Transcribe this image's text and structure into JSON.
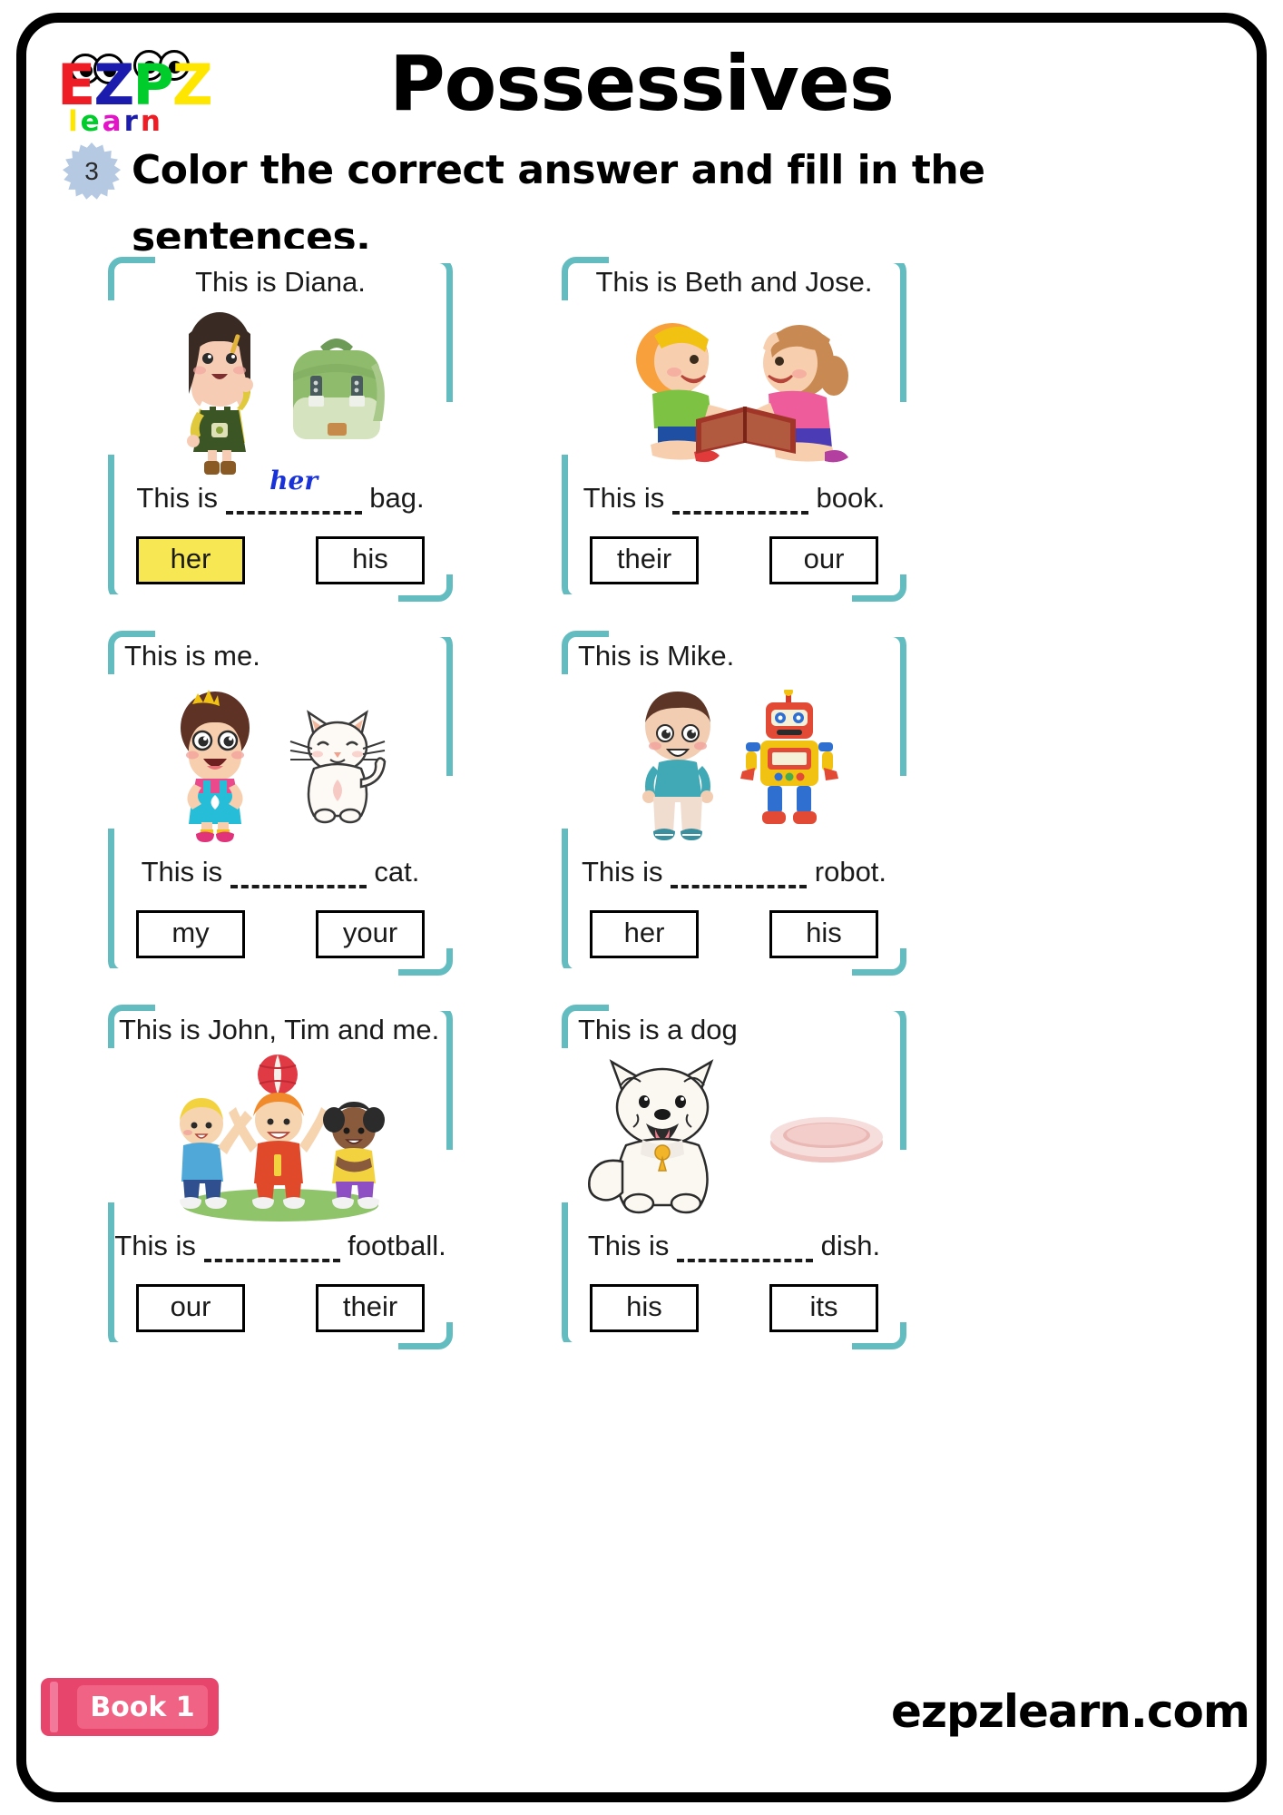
{
  "brand": {
    "logo_line1": [
      "E",
      "Z",
      "P",
      "Z"
    ],
    "logo_line2": [
      "l",
      "e",
      "a",
      "r",
      "n"
    ],
    "accent_teal": "#62bcc0",
    "accent_yellow": "#f7e752",
    "accent_blue_ink": "#1832d8",
    "accent_pink": "#e8456c",
    "badge_blue": "#b5c9e2"
  },
  "header": {
    "title": "Possessives"
  },
  "instruction": {
    "number": "3",
    "text": "Color the correct answer and fill in the sentences."
  },
  "cards": [
    {
      "id": "diana-bag",
      "title": "This is Diana.",
      "sentence_before": "This is",
      "sentence_after": "bag.",
      "answer": "her",
      "options": [
        {
          "label": "her",
          "selected": true
        },
        {
          "label": "his",
          "selected": false
        }
      ],
      "art": [
        "girl-green-dress",
        "green-backpack"
      ]
    },
    {
      "id": "beth-jose-book",
      "title": "This is Beth and Jose.",
      "sentence_before": "This is",
      "sentence_after": "book.",
      "answer": "",
      "options": [
        {
          "label": "their",
          "selected": false
        },
        {
          "label": "our",
          "selected": false
        }
      ],
      "art": [
        "two-kids-reading-book"
      ]
    },
    {
      "id": "me-cat",
      "title": "This is me.",
      "sentence_before": "This is",
      "sentence_after": "cat.",
      "answer": "",
      "options": [
        {
          "label": "my",
          "selected": false
        },
        {
          "label": "your",
          "selected": false
        }
      ],
      "art": [
        "girl-crown-blue-overalls",
        "white-cat"
      ]
    },
    {
      "id": "mike-robot",
      "title": "This is Mike.",
      "sentence_before": "This is",
      "sentence_after": "robot.",
      "answer": "",
      "options": [
        {
          "label": "her",
          "selected": false
        },
        {
          "label": "his",
          "selected": false
        }
      ],
      "art": [
        "boy-teal-shirt",
        "toy-robot"
      ]
    },
    {
      "id": "john-tim-me-football",
      "title": "This is John, Tim and me.",
      "sentence_before": "This is",
      "sentence_after": "football.",
      "answer": "",
      "options": [
        {
          "label": "our",
          "selected": false
        },
        {
          "label": "their",
          "selected": false
        }
      ],
      "art": [
        "three-kids-with-ball"
      ]
    },
    {
      "id": "dog-dish",
      "title": "This is a dog",
      "sentence_before": "This is",
      "sentence_after": "dish.",
      "answer": "",
      "options": [
        {
          "label": "his",
          "selected": false
        },
        {
          "label": "its",
          "selected": false
        }
      ],
      "art": [
        "white-dog",
        "pink-dish"
      ]
    }
  ],
  "footer": {
    "book_label": "Book 1",
    "website": "ezpzlearn.com"
  }
}
